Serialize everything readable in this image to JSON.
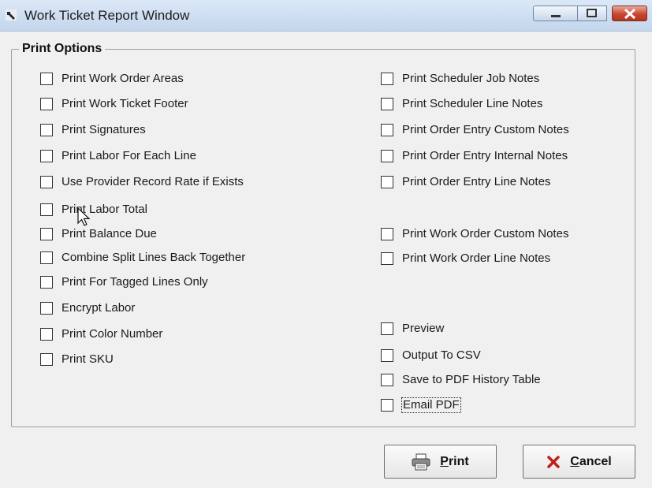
{
  "window": {
    "title": "Work Ticket Report Window"
  },
  "group": {
    "legend": "Print Options"
  },
  "options_left": [
    {
      "label": "Print Work Order Areas",
      "checked": false
    },
    {
      "label": "Print Work Ticket Footer",
      "checked": false
    },
    {
      "label": "Print Signatures",
      "checked": false
    },
    {
      "label": "Print Labor For Each Line",
      "checked": false
    },
    {
      "label": "Use Provider Record Rate if Exists",
      "checked": false
    },
    {
      "label": "Print Labor Total",
      "checked": false
    },
    {
      "label": "Print Balance Due",
      "checked": false
    },
    {
      "label": "Combine Split Lines Back Together",
      "checked": false
    },
    {
      "label": "Print For Tagged Lines Only",
      "checked": false
    },
    {
      "label": "Encrypt Labor",
      "checked": false
    },
    {
      "label": "Print Color Number",
      "checked": false
    },
    {
      "label": "Print SKU",
      "checked": false
    }
  ],
  "options_right": [
    {
      "label": "Print Scheduler Job Notes",
      "checked": false
    },
    {
      "label": "Print Scheduler Line Notes",
      "checked": false
    },
    {
      "label": "Print Order Entry Custom Notes",
      "checked": false
    },
    {
      "label": "Print Order Entry Internal Notes",
      "checked": false
    },
    {
      "label": "Print Order Entry Line Notes",
      "checked": false
    },
    {
      "label": "Print Work Order Custom Notes",
      "checked": false
    },
    {
      "label": "Print Work Order Line Notes",
      "checked": false
    },
    {
      "label": "Preview",
      "checked": false
    },
    {
      "label": "Output To CSV",
      "checked": false
    },
    {
      "label": "Save to PDF History Table",
      "checked": false
    },
    {
      "label": "Email PDF",
      "checked": false
    }
  ],
  "buttons": {
    "print_label": "Print",
    "cancel_label": "Cancel"
  },
  "icons": {
    "app": "wrench-icon",
    "print": "printer-icon",
    "cancel": "red-x-icon"
  },
  "colors": {
    "close_button": "#c8462f",
    "cancel_x": "#c0201b"
  }
}
